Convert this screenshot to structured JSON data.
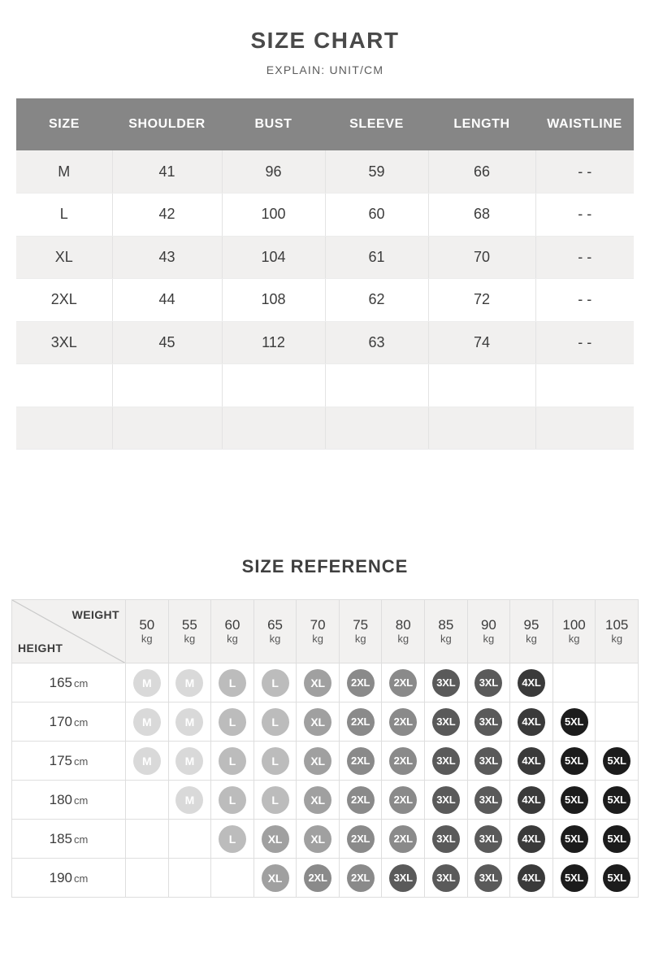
{
  "size_chart": {
    "title": "SIZE CHART",
    "explain": "EXPLAIN:  UNIT/CM",
    "columns": [
      "SIZE",
      "SHOULDER",
      "BUST",
      "SLEEVE",
      "LENGTH",
      "WAISTLINE"
    ],
    "rows": [
      [
        "M",
        "41",
        "96",
        "59",
        "66",
        "- -"
      ],
      [
        "L",
        "42",
        "100",
        "60",
        "68",
        "- -"
      ],
      [
        "XL",
        "43",
        "104",
        "61",
        "70",
        "- -"
      ],
      [
        "2XL",
        "44",
        "108",
        "62",
        "72",
        "- -"
      ],
      [
        "3XL",
        "45",
        "112",
        "63",
        "74",
        "- -"
      ],
      [
        "",
        "",
        "",
        "",
        "",
        ""
      ],
      [
        "",
        "",
        "",
        "",
        "",
        ""
      ]
    ]
  },
  "size_reference": {
    "title": "SIZE REFERENCE",
    "weight_label": "WEIGHT",
    "height_label": "HEIGHT",
    "weight_unit": "kg",
    "height_unit": "cm",
    "weights": [
      "50",
      "55",
      "60",
      "65",
      "70",
      "75",
      "80",
      "85",
      "90",
      "95",
      "100",
      "105"
    ],
    "heights": [
      "165",
      "170",
      "175",
      "180",
      "185",
      "190"
    ],
    "grid": [
      [
        "M",
        "M",
        "L",
        "L",
        "XL",
        "2XL",
        "2XL",
        "3XL",
        "3XL",
        "4XL",
        "",
        ""
      ],
      [
        "M",
        "M",
        "L",
        "L",
        "XL",
        "2XL",
        "2XL",
        "3XL",
        "3XL",
        "4XL",
        "5XL",
        ""
      ],
      [
        "M",
        "M",
        "L",
        "L",
        "XL",
        "2XL",
        "2XL",
        "3XL",
        "3XL",
        "4XL",
        "5XL",
        "5XL"
      ],
      [
        "",
        "M",
        "L",
        "L",
        "XL",
        "2XL",
        "2XL",
        "3XL",
        "3XL",
        "4XL",
        "5XL",
        "5XL"
      ],
      [
        "",
        "",
        "L",
        "XL",
        "XL",
        "2XL",
        "2XL",
        "3XL",
        "3XL",
        "4XL",
        "5XL",
        "5XL"
      ],
      [
        "",
        "",
        "",
        "XL",
        "2XL",
        "2XL",
        "3XL",
        "3XL",
        "3XL",
        "4XL",
        "5XL",
        "5XL"
      ]
    ],
    "bubble_colors": {
      "M": "#d9d9d9",
      "L": "#bcbcbc",
      "XL": "#a0a0a0",
      "2XL": "#8a8a8a",
      "3XL": "#5a5a5a",
      "4XL": "#3a3a3a",
      "5XL": "#1c1c1c"
    }
  },
  "theme": {
    "header_bg": "#868686",
    "stripe_bg": "#f1f0ef",
    "grid_line": "#dedede",
    "text": "#3c3c3c"
  }
}
